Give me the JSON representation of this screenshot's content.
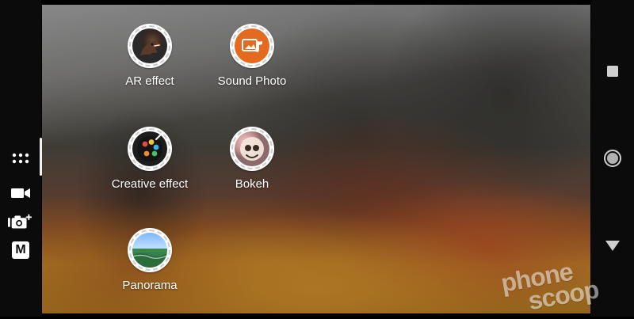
{
  "left_rail": {
    "modes": [
      {
        "id": "all-modes",
        "icon": "grid-icon"
      },
      {
        "id": "video",
        "icon": "video-camera-icon"
      },
      {
        "id": "camera-plus",
        "icon": "camera-plus-icon"
      },
      {
        "id": "manual",
        "icon": "manual-icon",
        "label": "M"
      }
    ]
  },
  "menu": {
    "items": [
      {
        "key": "ar_effect",
        "label": "AR effect",
        "icon": "dinosaur-icon"
      },
      {
        "key": "sound_photo",
        "label": "Sound Photo",
        "icon": "sound-photo-icon"
      },
      {
        "key": "creative_effect",
        "label": "Creative effect",
        "icon": "palette-icon"
      },
      {
        "key": "bokeh",
        "label": "Bokeh",
        "icon": "bokeh-icon"
      },
      {
        "key": "panorama",
        "label": "Panorama",
        "icon": "panorama-icon"
      }
    ]
  },
  "right_rail": {
    "buttons": [
      {
        "id": "recents",
        "icon": "square-icon"
      },
      {
        "id": "home",
        "icon": "circle-icon"
      },
      {
        "id": "back",
        "icon": "triangle-icon"
      }
    ]
  },
  "watermark": {
    "line1": "phone",
    "line2": "scoop"
  },
  "colors": {
    "rail_bg": "#0b0b0b",
    "label_text": "#ffffff",
    "sound_photo_accent": "#e46a1f"
  }
}
